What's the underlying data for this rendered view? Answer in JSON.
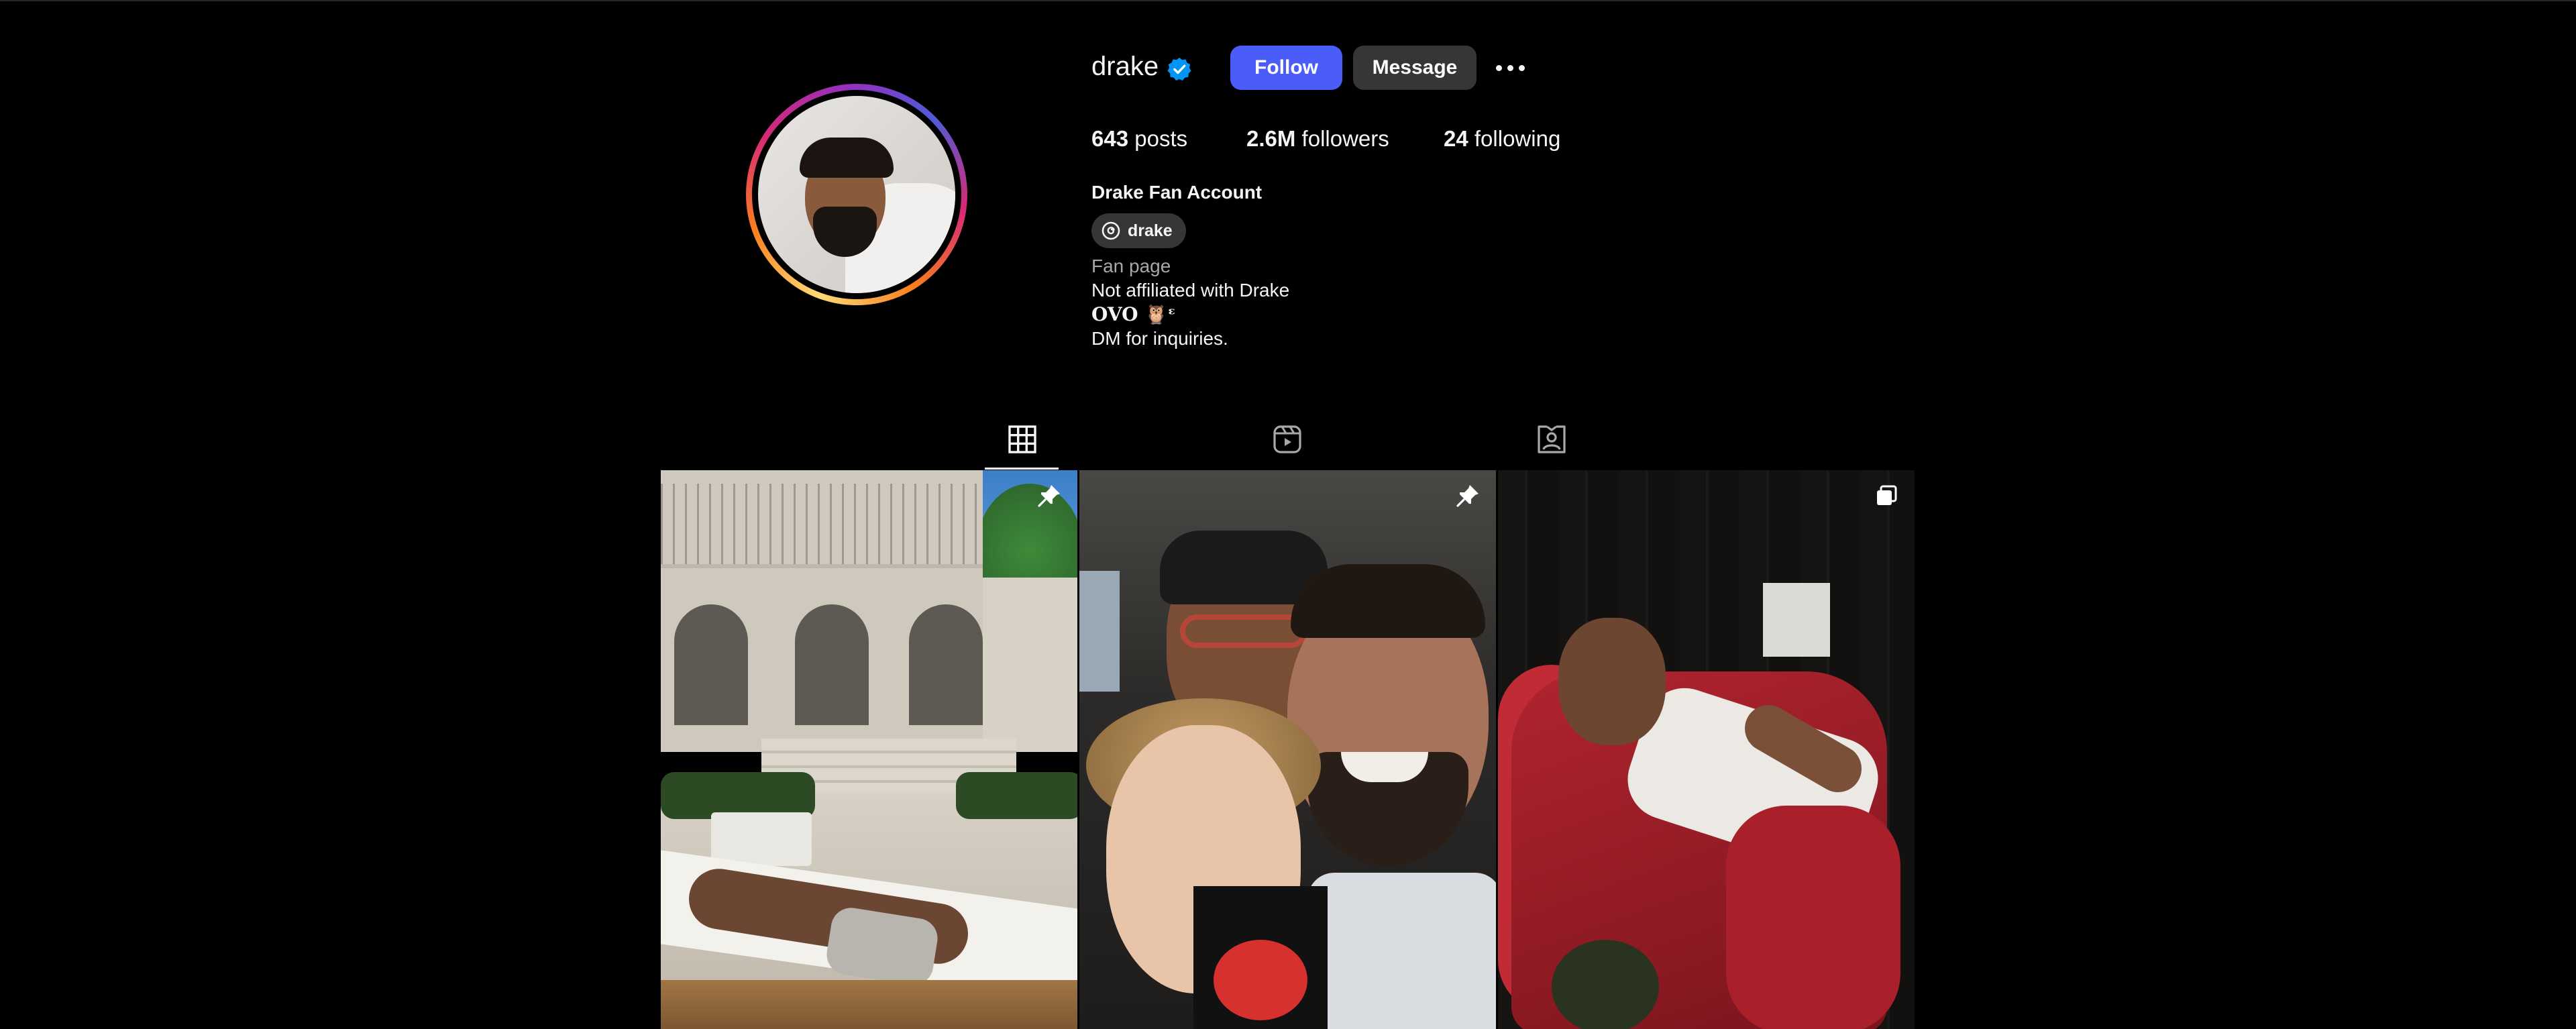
{
  "profile": {
    "username": "drake",
    "verified": true,
    "follow_label": "Follow",
    "message_label": "Message",
    "stats": {
      "posts_count": "643",
      "posts_label": "posts",
      "followers_count": "2.6M",
      "followers_label": "followers",
      "following_count": "24",
      "following_label": "following"
    },
    "full_name": "Drake Fan Account",
    "threads_handle": "drake",
    "category": "Fan page",
    "bio_lines": [
      "Not affiliated with Drake",
      "OVO 🦉ᵋ",
      "DM for inquiries."
    ]
  },
  "tabs": [
    {
      "name": "posts",
      "icon": "grid-icon",
      "active": true
    },
    {
      "name": "reels",
      "icon": "reels-icon",
      "active": false
    },
    {
      "name": "tagged",
      "icon": "tagged-icon",
      "active": false
    }
  ],
  "posts": [
    {
      "badge": "pin-icon"
    },
    {
      "badge": "pin-icon"
    },
    {
      "badge": "carousel-icon"
    }
  ],
  "colors": {
    "background": "#000000",
    "follow_button": "#4a5df9",
    "secondary_button": "#363636",
    "verified": "#0095f6"
  }
}
